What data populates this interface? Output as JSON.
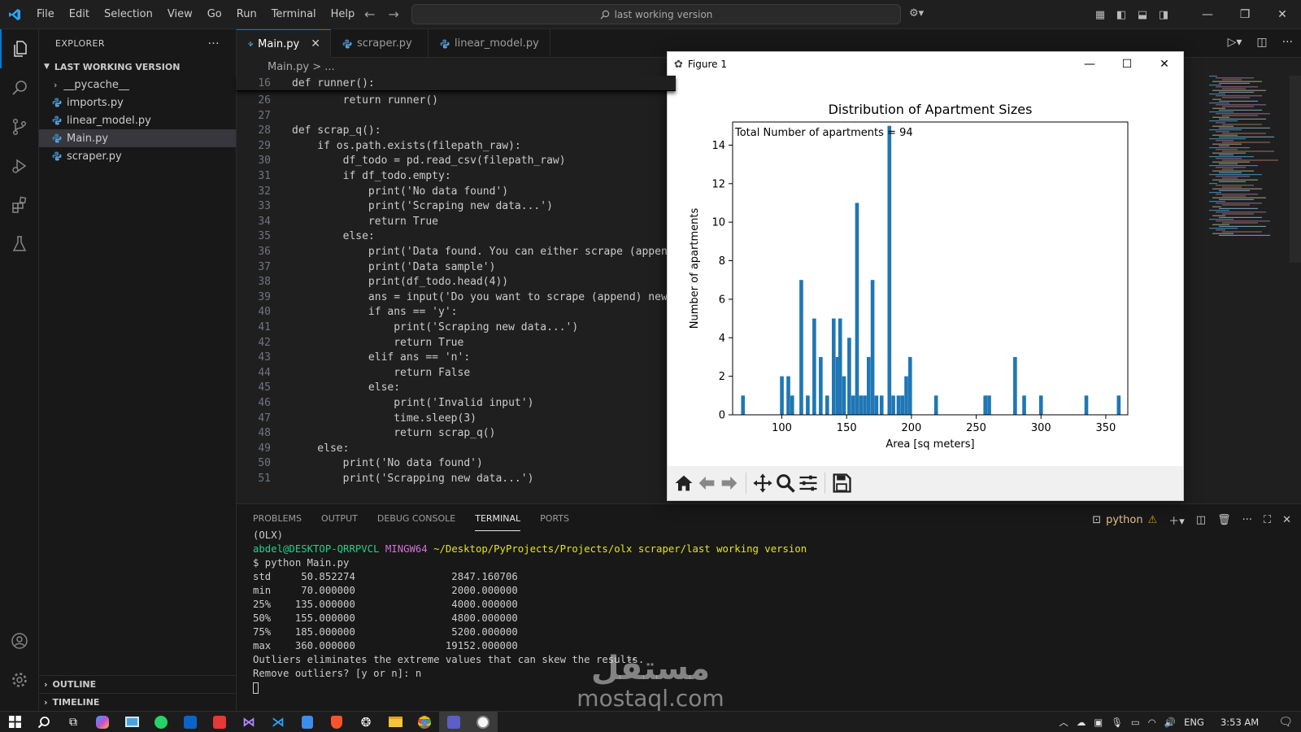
{
  "titlebar": {
    "menu": [
      "File",
      "Edit",
      "Selection",
      "View",
      "Go",
      "Run",
      "Terminal",
      "Help"
    ],
    "search_text": "last working version"
  },
  "sidebar": {
    "title": "EXPLORER",
    "more": "···",
    "folder": "LAST WORKING VERSION",
    "items": [
      {
        "label": "__pycache__",
        "type": "folder"
      },
      {
        "label": "imports.py",
        "type": "py"
      },
      {
        "label": "linear_model.py",
        "type": "py"
      },
      {
        "label": "Main.py",
        "type": "py",
        "selected": true
      },
      {
        "label": "scraper.py",
        "type": "py"
      }
    ],
    "outline": "OUTLINE",
    "timeline": "TIMELINE"
  },
  "tabs": [
    {
      "label": "Main.py",
      "active": true
    },
    {
      "label": "scraper.py",
      "active": false
    },
    {
      "label": "linear_model.py",
      "active": false
    }
  ],
  "breadcrumb": "Main.py  >  ...",
  "editor": {
    "sticky": {
      "ln": "16",
      "code": "def runner():"
    },
    "lines": [
      {
        "ln": "26",
        "code": "        return runner()"
      },
      {
        "ln": "27",
        "code": ""
      },
      {
        "ln": "28",
        "code": "def scrap_q():"
      },
      {
        "ln": "29",
        "code": "    if os.path.exists(filepath_raw):"
      },
      {
        "ln": "30",
        "code": "        df_todo = pd.read_csv(filepath_raw)"
      },
      {
        "ln": "31",
        "code": "        if df_todo.empty:"
      },
      {
        "ln": "32",
        "code": "            print('No data found')"
      },
      {
        "ln": "33",
        "code": "            print('Scraping new data...')"
      },
      {
        "ln": "34",
        "code": "            return True"
      },
      {
        "ln": "35",
        "code": "        else:"
      },
      {
        "ln": "36",
        "code": "            print('Data found. You can either scrape (append"
      },
      {
        "ln": "37",
        "code": "            print('Data sample')"
      },
      {
        "ln": "38",
        "code": "            print(df_todo.head(4))"
      },
      {
        "ln": "39",
        "code": "            ans = input('Do you want to scrape (append) new"
      },
      {
        "ln": "40",
        "code": "            if ans == 'y':"
      },
      {
        "ln": "41",
        "code": "                print('Scraping new data...')"
      },
      {
        "ln": "42",
        "code": "                return True"
      },
      {
        "ln": "43",
        "code": "            elif ans == 'n':"
      },
      {
        "ln": "44",
        "code": "                return False"
      },
      {
        "ln": "45",
        "code": "            else:"
      },
      {
        "ln": "46",
        "code": "                print('Invalid input')"
      },
      {
        "ln": "47",
        "code": "                time.sleep(3)"
      },
      {
        "ln": "48",
        "code": "                return scrap_q()"
      },
      {
        "ln": "49",
        "code": "    else:"
      },
      {
        "ln": "50",
        "code": "        print('No data found')"
      },
      {
        "ln": "51",
        "code": "        print('Scrapping new data...')"
      }
    ]
  },
  "panel": {
    "tabs": [
      "PROBLEMS",
      "OUTPUT",
      "DEBUG CONSOLE",
      "TERMINAL",
      "PORTS"
    ],
    "active_tab": "TERMINAL",
    "shell_label": "python",
    "terminal": {
      "env": "(OLX)",
      "user": "abdel@DESKTOP-QRRPVCL",
      "shell": "MINGW64",
      "path": "~/Desktop/PyProjects/Projects/olx scraper/last working version",
      "command": "$ python Main.py",
      "rows": [
        "std     50.852274                2847.160706",
        "min     70.000000                2000.000000",
        "25%    135.000000                4000.000000",
        "50%    155.000000                4800.000000",
        "75%    185.000000                5200.000000",
        "max    360.000000               19152.000000"
      ],
      "msg1": "Outliers eliminates the extreme values that can skew the results.",
      "msg2": "Remove outliers? [y or n]: n"
    }
  },
  "figure": {
    "window_title": "Figure 1"
  },
  "chart_data": {
    "type": "bar",
    "title": "Distribution of Apartment Sizes",
    "xlabel": "Area [sq meters]",
    "ylabel": "Number of apartments",
    "annotation": "Total Number of apartments = 94",
    "xlim": [
      62,
      367
    ],
    "ylim": [
      0,
      15.2
    ],
    "xticks": [
      100,
      150,
      200,
      250,
      300,
      350
    ],
    "yticks": [
      0,
      2,
      4,
      6,
      8,
      10,
      12,
      14
    ],
    "bin_width": 2.9,
    "color": "#1f77b4",
    "bars": [
      {
        "x": 70,
        "y": 1
      },
      {
        "x": 100,
        "y": 2
      },
      {
        "x": 105,
        "y": 2
      },
      {
        "x": 108,
        "y": 1
      },
      {
        "x": 115,
        "y": 7
      },
      {
        "x": 120,
        "y": 1
      },
      {
        "x": 125,
        "y": 5
      },
      {
        "x": 130,
        "y": 3
      },
      {
        "x": 135,
        "y": 1
      },
      {
        "x": 140,
        "y": 5
      },
      {
        "x": 143,
        "y": 3
      },
      {
        "x": 145,
        "y": 5
      },
      {
        "x": 148,
        "y": 2
      },
      {
        "x": 152,
        "y": 4
      },
      {
        "x": 155,
        "y": 1
      },
      {
        "x": 158,
        "y": 11
      },
      {
        "x": 161,
        "y": 1
      },
      {
        "x": 164,
        "y": 1
      },
      {
        "x": 167,
        "y": 3
      },
      {
        "x": 170,
        "y": 7
      },
      {
        "x": 173,
        "y": 1
      },
      {
        "x": 177,
        "y": 1
      },
      {
        "x": 183,
        "y": 15
      },
      {
        "x": 186,
        "y": 1
      },
      {
        "x": 190,
        "y": 1
      },
      {
        "x": 193,
        "y": 1
      },
      {
        "x": 196,
        "y": 2
      },
      {
        "x": 199,
        "y": 3
      },
      {
        "x": 219,
        "y": 1
      },
      {
        "x": 257,
        "y": 1
      },
      {
        "x": 260,
        "y": 1
      },
      {
        "x": 280,
        "y": 3
      },
      {
        "x": 287,
        "y": 1
      },
      {
        "x": 300,
        "y": 1
      },
      {
        "x": 335,
        "y": 1
      },
      {
        "x": 360,
        "y": 1
      }
    ]
  },
  "taskbar": {
    "lang": "ENG",
    "time": "3:53 AM"
  },
  "watermark": {
    "arabic": "مستقل",
    "latin": "mostaql.com"
  }
}
